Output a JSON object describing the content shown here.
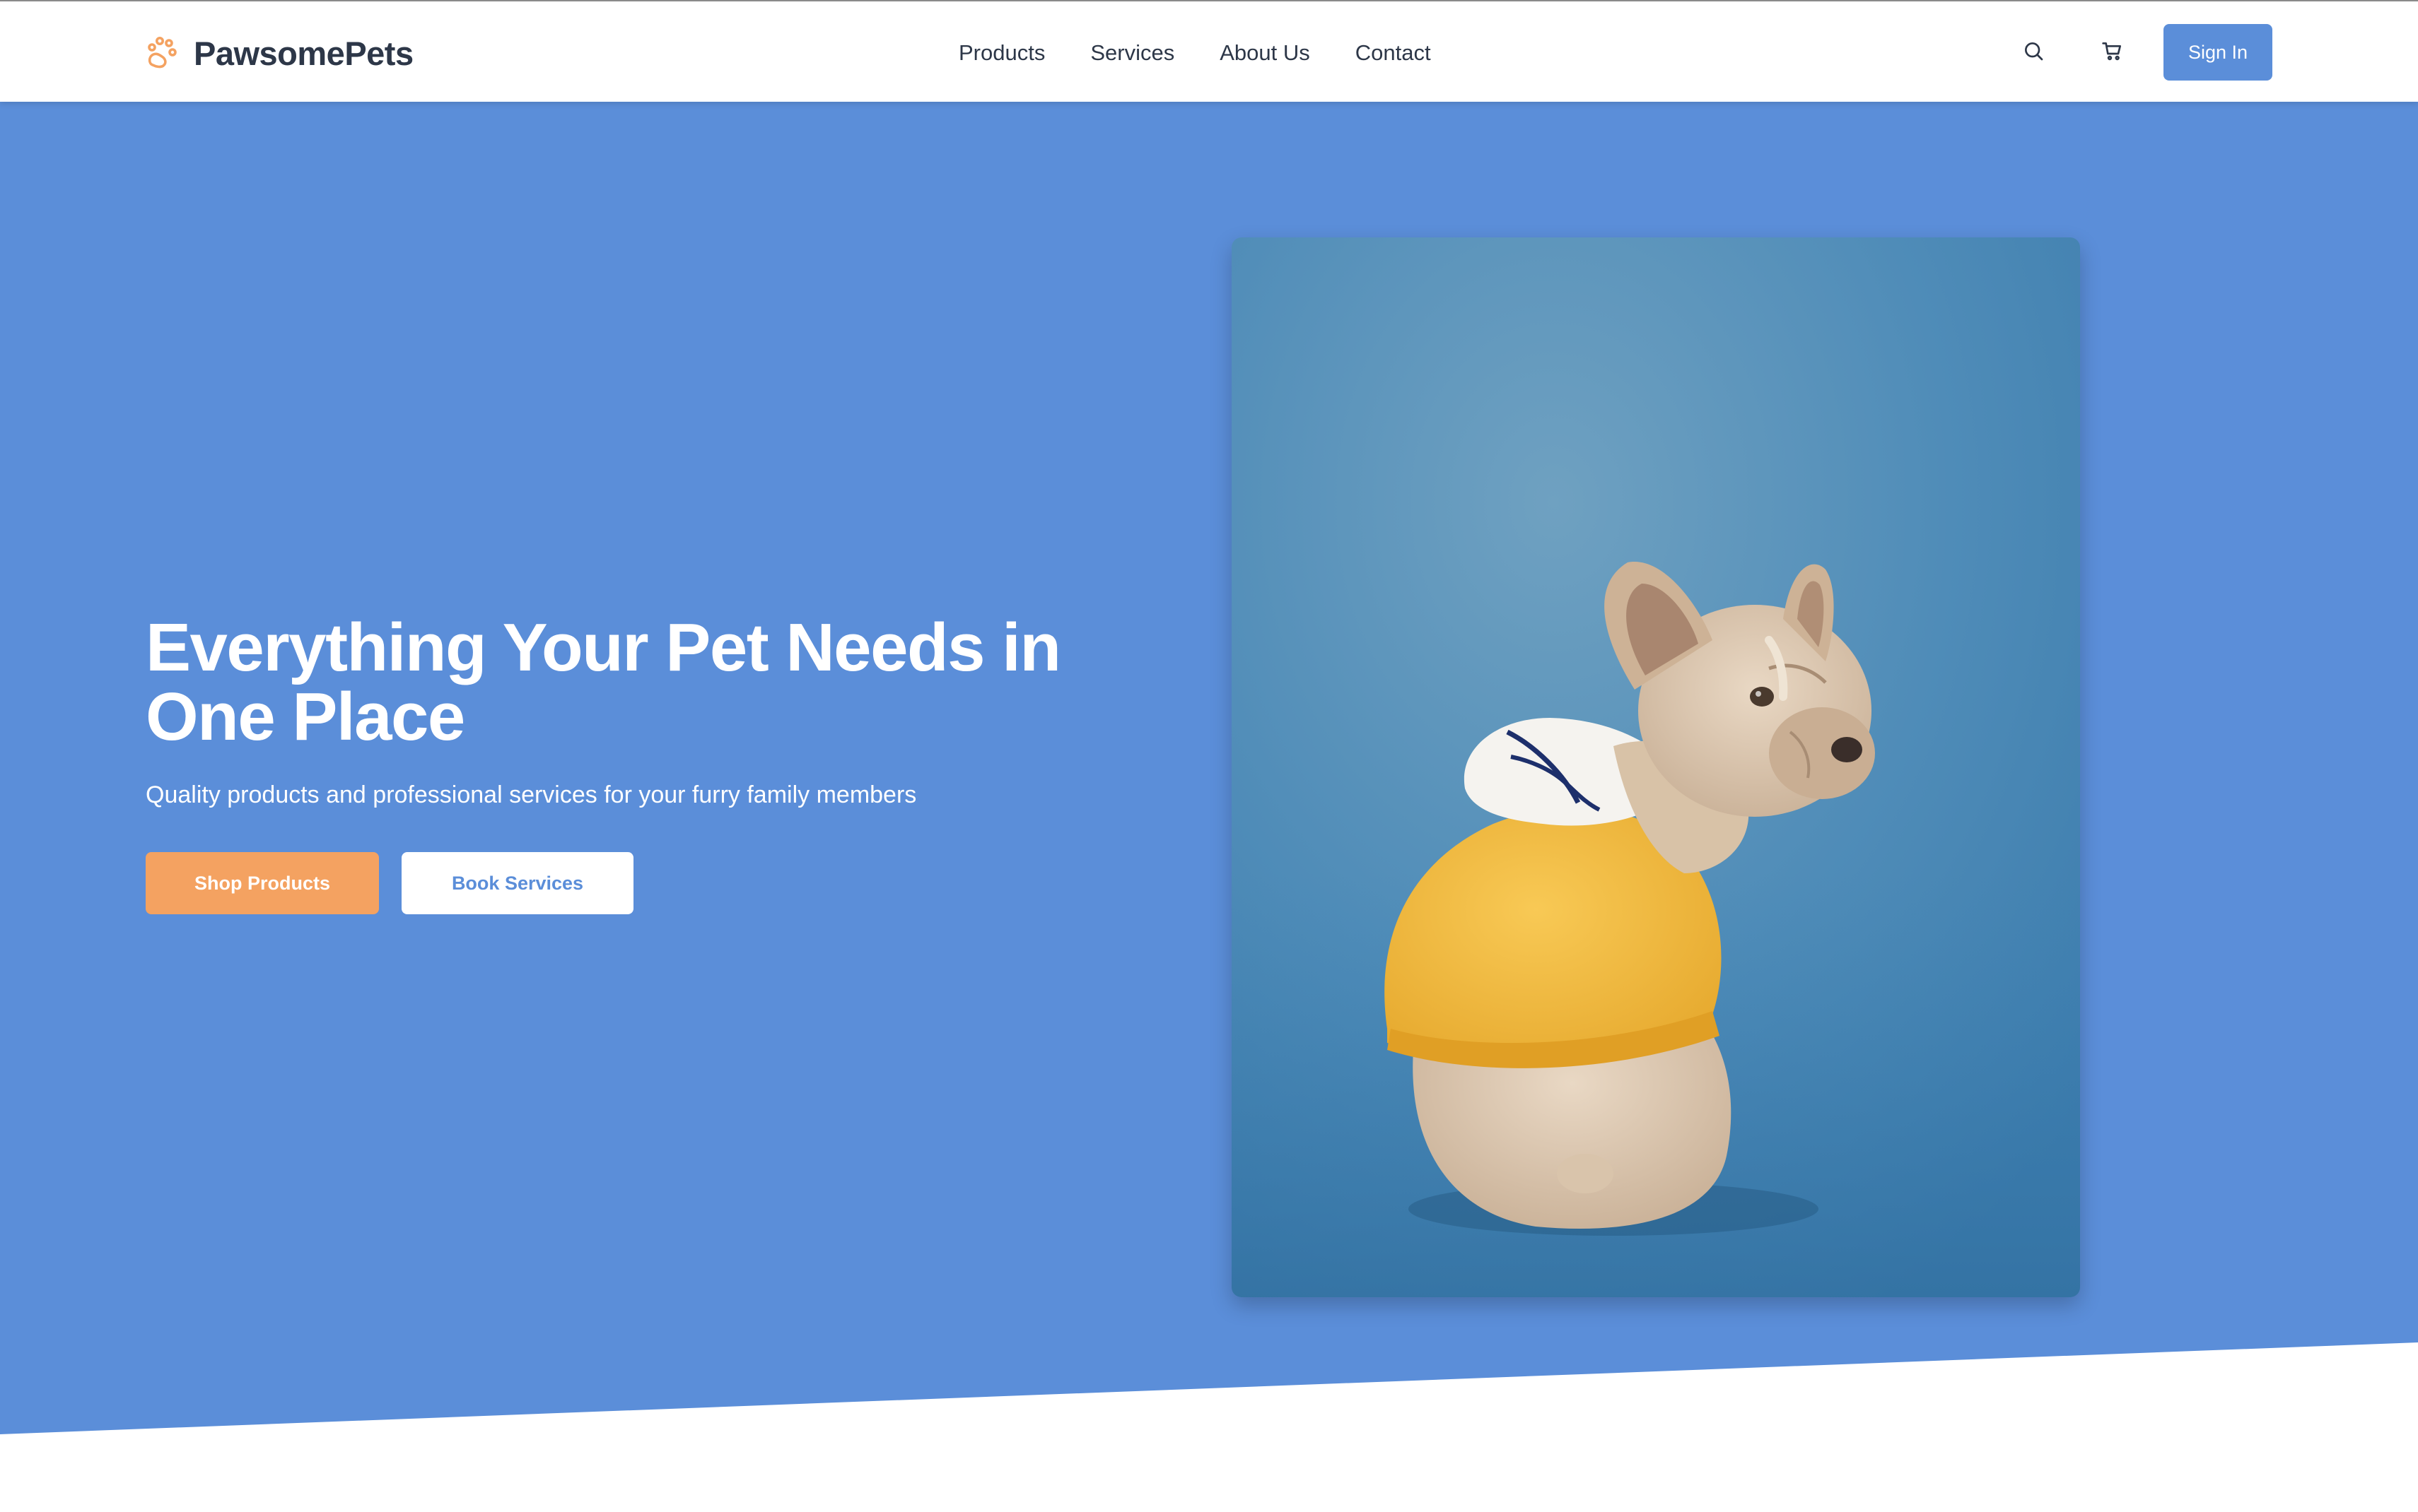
{
  "brand": {
    "name": "PawsomePets",
    "icon": "paw-icon",
    "accent_color": "#f4a261"
  },
  "nav": {
    "items": [
      {
        "label": "Products"
      },
      {
        "label": "Services"
      },
      {
        "label": "About Us"
      },
      {
        "label": "Contact"
      }
    ]
  },
  "header": {
    "search_icon": "search-icon",
    "cart_icon": "cart-icon",
    "signin_label": "Sign In"
  },
  "hero": {
    "title": "Everything Your Pet Needs in One Place",
    "subtitle": "Quality products and professional services for your furry family members",
    "primary_button": "Shop Products",
    "secondary_button": "Book Services",
    "background_color": "#5b8ed9",
    "image_subject": "french-bulldog-yellow-hoodie-photo"
  },
  "colors": {
    "primary": "#5b8ed9",
    "accent": "#f4a261",
    "text_dark": "#2d3748"
  }
}
